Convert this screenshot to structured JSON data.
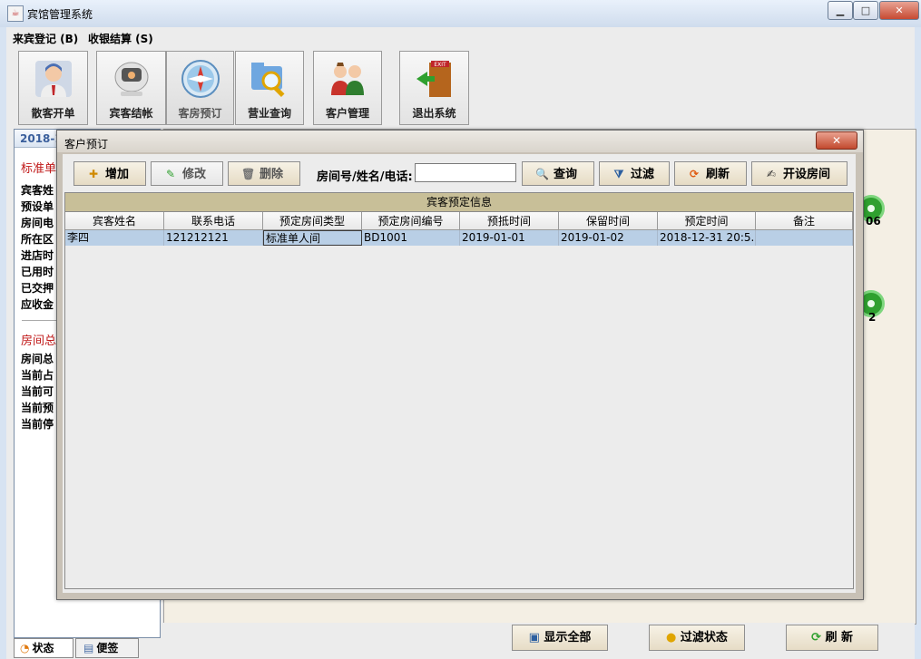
{
  "window": {
    "title": "宾馆管理系统",
    "minimize": "▁",
    "maximize": "□",
    "close": "✕"
  },
  "menu": {
    "items": [
      {
        "label": "来宾登记 (B)"
      },
      {
        "label": "收银结算 (S)"
      }
    ]
  },
  "toolbar": {
    "buttons": [
      {
        "label": "散客开单",
        "icon": "person-icon"
      },
      {
        "label": "宾客结帐",
        "icon": "monitor-icon"
      },
      {
        "label": "客房预订",
        "icon": "compass-icon"
      },
      {
        "label": "营业查询",
        "icon": "magnifier-folder-icon"
      },
      {
        "label": "客户管理",
        "icon": "people-icon"
      },
      {
        "label": "退出系统",
        "icon": "exit-door-icon"
      }
    ]
  },
  "left_panel": {
    "date": "2018-1",
    "section1_title": "标准单",
    "section1_lines": [
      "宾客姓",
      "预设单",
      "房间电",
      "所在区",
      "进店时",
      "已用时",
      "已交押",
      "应收金"
    ],
    "section2_title": "房间总",
    "section2_lines": [
      "房间总",
      "当前占",
      "当前可",
      "当前预",
      "当前停"
    ]
  },
  "bottom_tabs": [
    {
      "label": "状态"
    },
    {
      "label": "便签"
    }
  ],
  "rooms": [
    {
      "number": "06"
    },
    {
      "number": "2"
    }
  ],
  "bottom_buttons": [
    {
      "label": "显示全部"
    },
    {
      "label": "过滤状态"
    },
    {
      "label": "刷 新"
    }
  ],
  "dialog": {
    "title": "客户预订",
    "close": "✕",
    "buttons": [
      {
        "label": "增加",
        "icon": "add-doc-icon"
      },
      {
        "label": "修改",
        "icon": "edit-icon"
      },
      {
        "label": "删除",
        "icon": "trash-icon"
      }
    ],
    "search_label": "房间号/姓名/电话:",
    "search_value": "",
    "action_buttons": [
      {
        "label": "查询",
        "icon": "search-icon"
      },
      {
        "label": "过滤",
        "icon": "filter-icon"
      },
      {
        "label": "刷新",
        "icon": "refresh-icon"
      },
      {
        "label": "开设房间",
        "icon": "open-room-icon"
      }
    ],
    "grid_caption": "宾客预定信息",
    "columns": [
      "宾客姓名",
      "联系电话",
      "预定房间类型",
      "预定房间编号",
      "预抵时间",
      "保留时间",
      "预定时间",
      "备注"
    ],
    "rows": [
      [
        "李四",
        "121212121",
        "标准单人间",
        "BD1001",
        "2019-01-01",
        "2019-01-02",
        "2018-12-31 20:5...",
        ""
      ]
    ]
  }
}
